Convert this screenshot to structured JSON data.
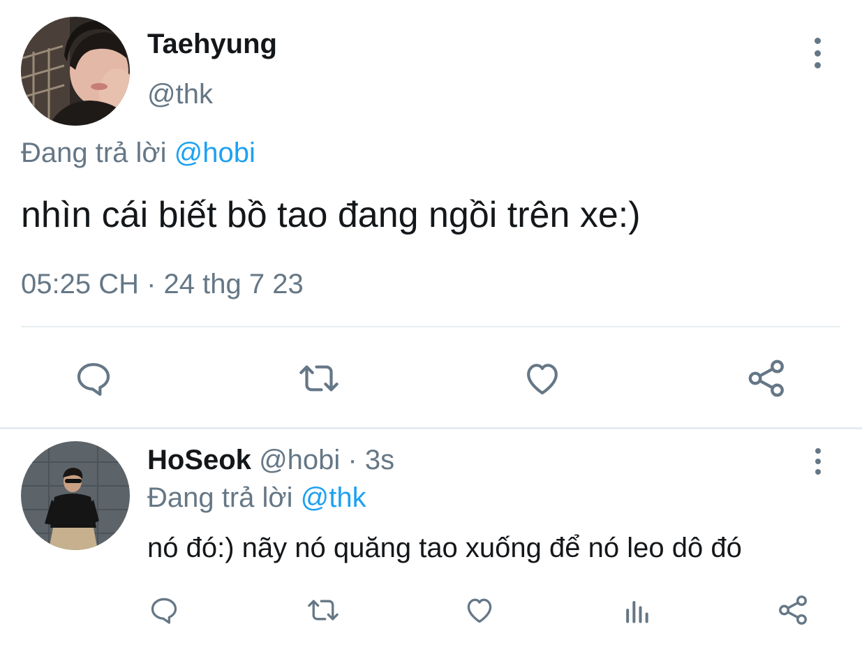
{
  "main_tweet": {
    "author_name": "Taehyung",
    "handle": "@thk",
    "reply_prefix": "Đang trả lời",
    "reply_to": "@hobi",
    "text": "nhìn cái biết bồ tao đang ngồi trên xe:)",
    "timestamp": "05:25 CH · 24 thg 7 23",
    "actions": [
      "reply-icon",
      "retweet-icon",
      "like-icon",
      "share-icon"
    ]
  },
  "reply_tweet": {
    "author_name": "HoSeok",
    "handle": "@hobi",
    "time": "· 3s",
    "reply_prefix": "Đang trả lời",
    "reply_to": "@thk",
    "text": "nó đó:) nãy nó quăng tao xuống để nó leo dô đó",
    "actions": [
      "reply-icon",
      "retweet-icon",
      "like-icon",
      "analytics-icon",
      "share-icon"
    ]
  },
  "colors": {
    "text": "#14171a",
    "muted": "#657786",
    "link": "#1da1f2",
    "divider": "#e6ecf0"
  }
}
